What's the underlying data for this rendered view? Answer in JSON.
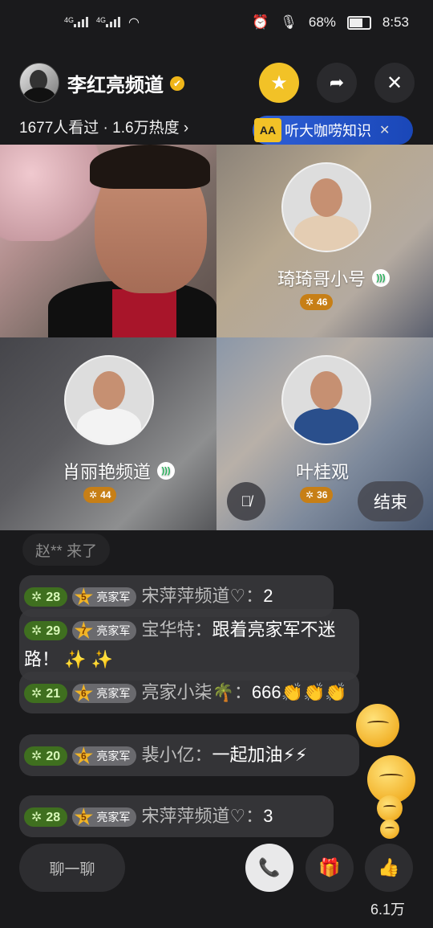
{
  "status": {
    "network1": "4G",
    "network2": "4G",
    "battery": "68%",
    "time": "8:53"
  },
  "header": {
    "channel_name": "李红亮频道",
    "stats": "1677人看过 · 1.6万热度 ›",
    "promo_text": "听大咖唠知识",
    "promo_close": "✕"
  },
  "guests": [
    {
      "name": "琦琦哥小号",
      "heat": "46"
    },
    {
      "name": "肖丽艳频道",
      "heat": "44"
    },
    {
      "name": "叶桂观",
      "heat": "36"
    }
  ],
  "controls": {
    "end_label": "结束"
  },
  "chat": {
    "joined": "赵** 来了",
    "messages": [
      {
        "level": "28",
        "fan_level": "5",
        "fan_tag": "亮家军",
        "user": "宋萍萍频道♡：",
        "text": "2"
      },
      {
        "level": "29",
        "fan_level": "7",
        "fan_tag": "亮家军",
        "user": "宝华特：",
        "text": "跟着亮家军不迷路！ ✨ ✨"
      },
      {
        "level": "21",
        "fan_level": "6",
        "fan_tag": "亮家军",
        "user": "亮家小柒🌴：",
        "text": "666👏👏👏"
      },
      {
        "level": "20",
        "fan_level": "6",
        "fan_tag": "亮家军",
        "user": "裴小亿：",
        "text": "一起加油⚡⚡"
      },
      {
        "level": "28",
        "fan_level": "5",
        "fan_tag": "亮家军",
        "user": "宋萍萍频道♡：",
        "text": "3"
      }
    ]
  },
  "bottom": {
    "chat_placeholder": "聊一聊",
    "like_count": "6.1万"
  }
}
